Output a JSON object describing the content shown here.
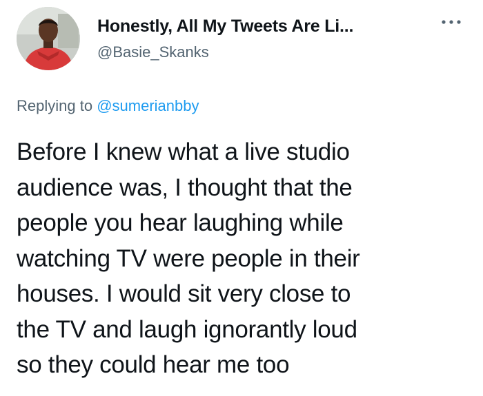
{
  "author": {
    "display_name": "Honestly, All My Tweets Are Li...",
    "handle": "@Basie_Skanks",
    "avatar_icon": "profile-photo"
  },
  "more_icon": "more-horizontal-icon",
  "reply": {
    "prefix": "Replying to",
    "handle": "@sumerianbby"
  },
  "tweet": {
    "text": "Before I knew what a live studio\naudience was, I thought that the\npeople you hear laughing while\nwatching TV were people in their\nhouses. I would sit very close to\nthe TV and laugh ignorantly loud\nso they could hear me too"
  },
  "colors": {
    "accent": "#1d9bf0",
    "secondary_text": "#536471",
    "primary_text": "#0f1419"
  }
}
